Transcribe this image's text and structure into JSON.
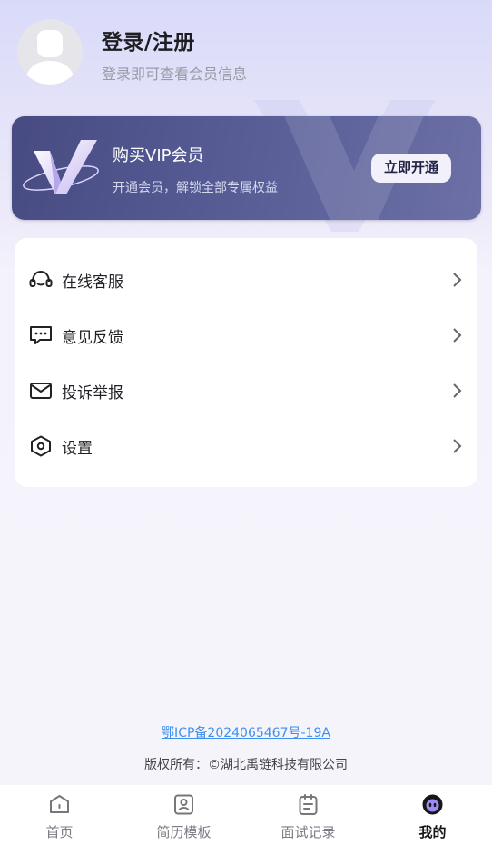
{
  "profile": {
    "title": "登录/注册",
    "subtitle": "登录即可查看会员信息"
  },
  "vip": {
    "title": "购买VIP会员",
    "subtitle": "开通会员，解锁全部专属权益",
    "button": "立即开通"
  },
  "menu": {
    "items": [
      {
        "label": "在线客服",
        "icon": "headset-icon"
      },
      {
        "label": "意见反馈",
        "icon": "feedback-icon"
      },
      {
        "label": "投诉举报",
        "icon": "mail-icon"
      },
      {
        "label": "设置",
        "icon": "settings-icon"
      }
    ]
  },
  "footer": {
    "icp": "鄂ICP备2024065467号-19A",
    "copyright": "版权所有：©湖北禹链科技有限公司"
  },
  "tabs": [
    {
      "label": "首页",
      "icon": "home-icon"
    },
    {
      "label": "简历模板",
      "icon": "resume-icon"
    },
    {
      "label": "面试记录",
      "icon": "record-icon"
    },
    {
      "label": "我的",
      "icon": "profile-icon",
      "active": true
    }
  ],
  "colors": {
    "vip_card": "#4f548c",
    "link": "#3d8ff0",
    "active_tab": "#151518",
    "inactive_tab": "#7b7b84"
  }
}
